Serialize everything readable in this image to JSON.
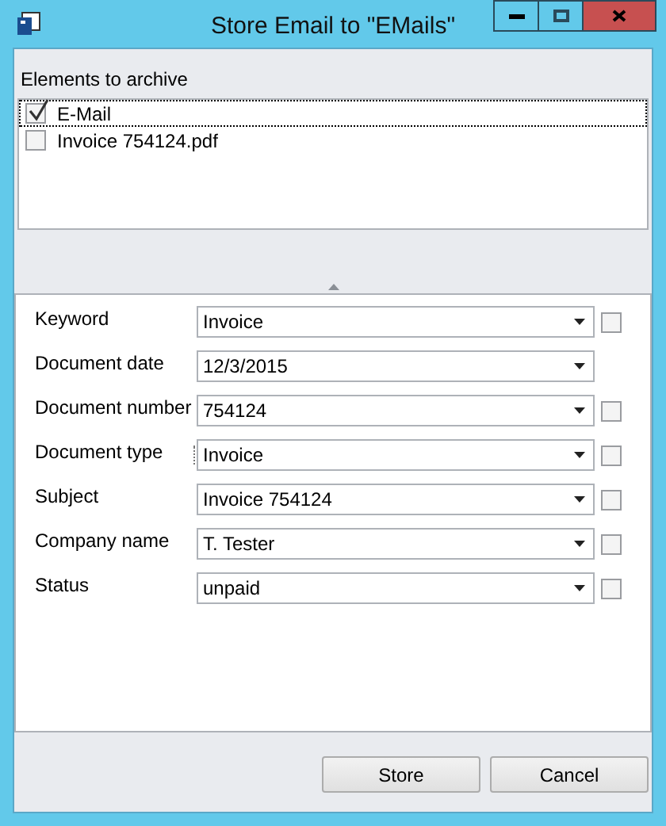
{
  "window": {
    "title": "Store Email to \"EMails\""
  },
  "archive": {
    "label": "Elements to archive",
    "items": [
      {
        "name": "E-Mail",
        "checked": true,
        "selected": true
      },
      {
        "name": "Invoice 754124.pdf",
        "checked": false,
        "selected": false
      }
    ]
  },
  "fields": [
    {
      "label": "Keyword",
      "value": "Invoice",
      "checked": false
    },
    {
      "label": "Document date",
      "value": "12/3/2015"
    },
    {
      "label": "Document number",
      "value": "754124",
      "checked": false
    },
    {
      "label": "Document type",
      "value": "Invoice",
      "checked": false
    },
    {
      "label": "Subject",
      "value": "Invoice 754124",
      "checked": false
    },
    {
      "label": "Company name",
      "value": "T. Tester",
      "checked": false
    },
    {
      "label": "Status",
      "value": "unpaid",
      "checked": false
    }
  ],
  "buttons": [
    "Store",
    "Cancel"
  ]
}
